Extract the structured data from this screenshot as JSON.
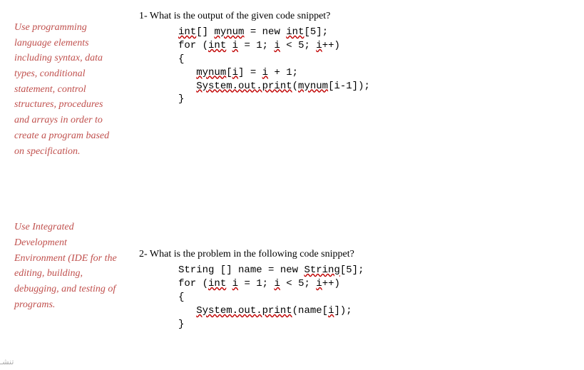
{
  "sidebar": {
    "block1": "Use programming language elements including syntax, data types, conditional statement, control structures, procedures and arrays in order to create a program based on specification.",
    "block2": "Use Integrated Development Environment (IDE for the editing, building, debugging, and testing of programs."
  },
  "questions": {
    "q1": {
      "title": "1- What is the output of the given code snippet?",
      "code": {
        "line1_a": "int",
        "line1_b": "[] ",
        "line1_c": "mynum",
        "line1_d": " = new ",
        "line1_e": "int",
        "line1_f": "[5];",
        "line2_a": "for (",
        "line2_b": "int",
        "line2_c": " ",
        "line2_d": "i",
        "line2_e": " = 1; ",
        "line2_f": "i",
        "line2_g": " < 5; ",
        "line2_h": "i",
        "line2_i": "++)",
        "line3": "{",
        "line4_a": "   ",
        "line4_b": "mynum",
        "line4_c": "[",
        "line4_d": "i",
        "line4_e": "] = ",
        "line4_f": "i",
        "line4_g": " + 1;",
        "line5_a": "   ",
        "line5_b": "System.out.print",
        "line5_c": "(",
        "line5_d": "mynum",
        "line5_e": "[i-1]);",
        "line6": "}"
      }
    },
    "q2": {
      "title": "2- What is the problem in the following code snippet?",
      "code": {
        "line1_a": "String [] name = new ",
        "line1_b": "String",
        "line1_c": "[5];",
        "line2_a": "for (",
        "line2_b": "int",
        "line2_c": " ",
        "line2_d": "i",
        "line2_e": " = 1; ",
        "line2_f": "i",
        "line2_g": " < 5; ",
        "line2_h": "i",
        "line2_i": "++)",
        "line3": "{",
        "line4_a": "   ",
        "line4_b": "System.out.print",
        "line4_c": "(name[",
        "line4_d": "i",
        "line4_e": "]);",
        "line5": "}"
      }
    }
  },
  "bottom_text": "تنشـ"
}
